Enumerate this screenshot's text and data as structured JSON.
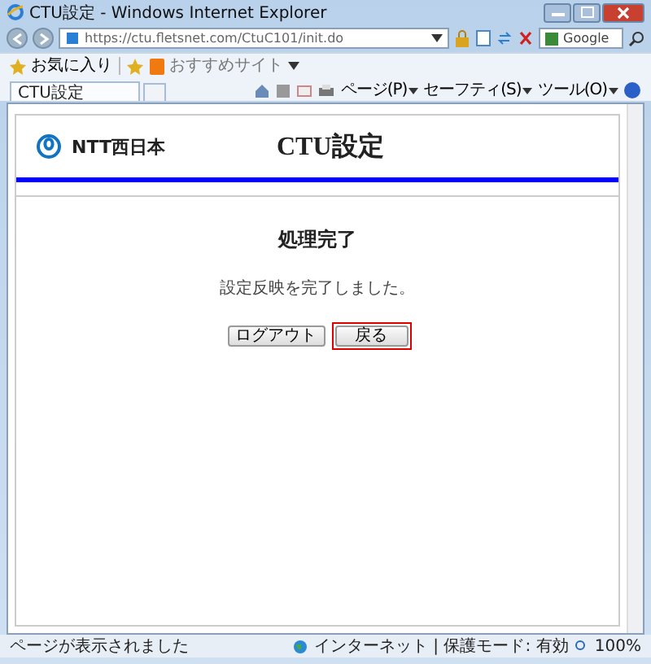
{
  "window": {
    "title": "CTU設定 - Windows Internet Explorer"
  },
  "address_bar": {
    "url": "https://ctu.fletsnet.com/CtuC101/init.do"
  },
  "search": {
    "placeholder": "Google"
  },
  "favorites_bar": {
    "favorites": "お気に入り",
    "suggested_sites": "おすすめサイト"
  },
  "tabs": [
    {
      "label": "CTU設定",
      "selected": true
    }
  ],
  "command_bar": [
    "ページ(P)",
    "セーフティ(S)",
    "ツール(O)"
  ],
  "page": {
    "brand": "NTT西日本",
    "title": "CTU設定",
    "heading": "処理完了",
    "message": "設定反映を完了しました。",
    "buttons": [
      {
        "label": "ログアウト",
        "selected": false
      },
      {
        "label": "戻る",
        "selected": true
      }
    ]
  },
  "status_bar": {
    "text": "ページが表示されました",
    "zone": "インターネット | 保護モード: 有効",
    "zoom": "100%"
  }
}
